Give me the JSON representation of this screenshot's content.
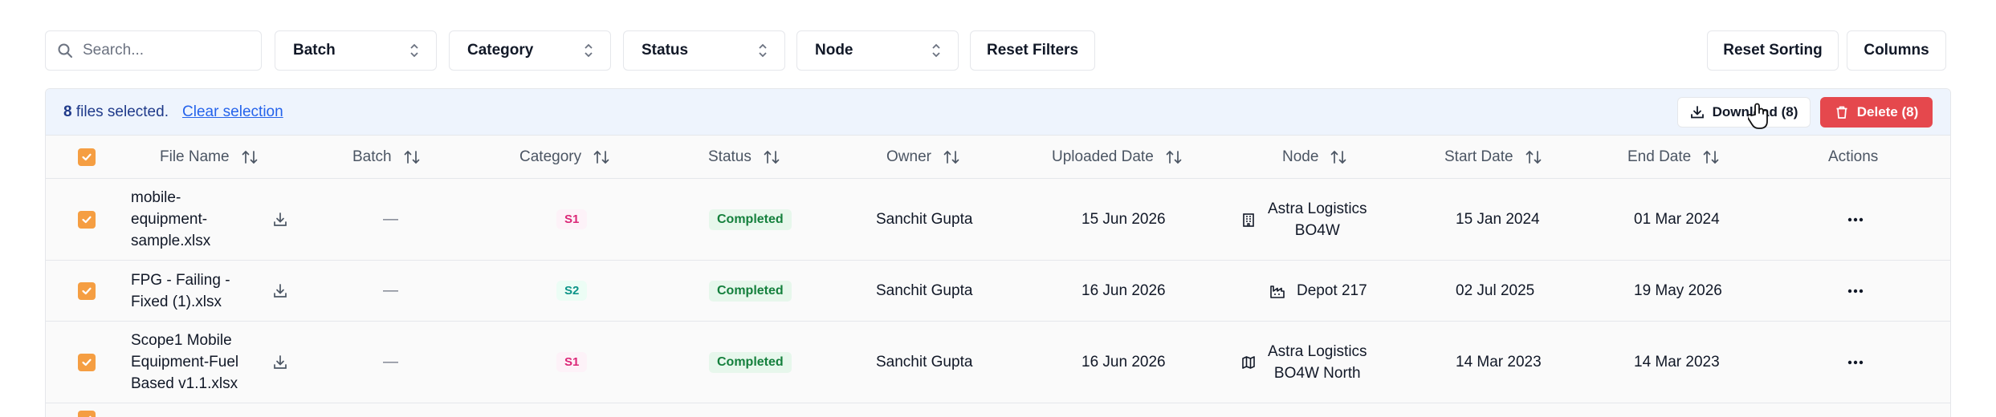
{
  "filters": {
    "search_placeholder": "Search...",
    "batch_label": "Batch",
    "category_label": "Category",
    "status_label": "Status",
    "node_label": "Node",
    "reset_filters_label": "Reset Filters",
    "reset_sorting_label": "Reset Sorting",
    "columns_label": "Columns"
  },
  "selection": {
    "count": "8",
    "text": "files selected.",
    "clear_label": "Clear selection",
    "download_label": "Download (8)",
    "delete_label": "Delete (8)"
  },
  "columns": {
    "file_name": "File Name",
    "batch": "Batch",
    "category": "Category",
    "status": "Status",
    "owner": "Owner",
    "uploaded_date": "Uploaded Date",
    "node": "Node",
    "start_date": "Start Date",
    "end_date": "End Date",
    "actions": "Actions"
  },
  "rows": [
    {
      "file_name": [
        "mobile-",
        "equipment-",
        "sample.xlsx"
      ],
      "batch": "—",
      "category": "S1",
      "status": "Completed",
      "owner": "Sanchit Gupta",
      "uploaded_date": "15 Jun 2026",
      "node_icon": "building-icon",
      "node": [
        "Astra Logistics",
        "BO4W"
      ],
      "start_date": "15 Jan 2024",
      "end_date": "01 Mar 2024"
    },
    {
      "file_name": [
        "FPG - Failing -",
        "Fixed (1).xlsx"
      ],
      "batch": "—",
      "category": "S2",
      "status": "Completed",
      "owner": "Sanchit Gupta",
      "uploaded_date": "16 Jun 2026",
      "node_icon": "factory-icon",
      "node": [
        "Depot 217"
      ],
      "start_date": "02 Jul 2025",
      "end_date": "19 May 2026"
    },
    {
      "file_name": [
        "Scope1 Mobile",
        "Equipment-Fuel",
        "Based v1.1.xlsx"
      ],
      "batch": "—",
      "category": "S1",
      "status": "Completed",
      "owner": "Sanchit Gupta",
      "uploaded_date": "16 Jun 2026",
      "node_icon": "map-icon",
      "node": [
        "Astra Logistics",
        "BO4W North"
      ],
      "start_date": "14 Mar 2023",
      "end_date": "14 Mar 2023"
    }
  ],
  "colors": {
    "accent_orange": "#f59e42",
    "selection_bg": "#eef4fd",
    "link_blue": "#2563eb",
    "delete_red": "#e5484d",
    "status_green": "#15803d"
  }
}
